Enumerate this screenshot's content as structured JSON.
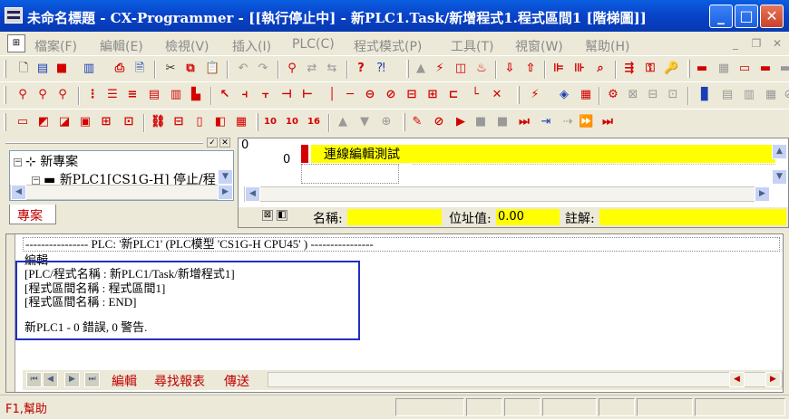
{
  "window": {
    "title": "未命名標題 - CX-Programmer - [[執行停止中] - 新PLC1.Task/新增程式1.程式區間1 [階梯圖]]",
    "minimize": "_",
    "maximize": "□",
    "close": "✕"
  },
  "menu": {
    "items": [
      "檔案(F)",
      "編輯(E)",
      "檢視(V)",
      "插入(I)",
      "PLC(C)",
      "程式模式(P)",
      "工具(T)",
      "視窗(W)",
      "幫助(H)"
    ],
    "mdi_minimize": "_",
    "mdi_restore": "❐",
    "mdi_close": "✕"
  },
  "project": {
    "root": "新專案",
    "plc": "新PLC1[CS1G-H] 停止/程",
    "tab": "專案"
  },
  "ladder": {
    "step": "0",
    "rung": "0",
    "rung_comment": "連線編輯測試",
    "name_label": "名稱:",
    "name_value": "",
    "address_label": "位址值:",
    "address_value": "0.00",
    "comment_label": "註解:",
    "comment_value": ""
  },
  "output": {
    "header": "---------------- PLC: '新PLC1' (PLC模型 'CS1G-H CPU45' ) ----------------",
    "section": "編輯",
    "lines": [
      "[PLC/程式名稱 : 新PLC1/Task/新增程式1]",
      "[程式區間名稱 : 程式區間1]",
      "[程式區間名稱 : END]",
      "新PLC1 - 0 錯誤, 0 警告."
    ],
    "tabs": [
      "編輯",
      "尋找報表",
      "傳送"
    ]
  },
  "status": {
    "help": "F1,幫助"
  },
  "colors": {
    "title_bar": "#0a5ee0",
    "highlight": "#ffff00",
    "tab_text": "#c00000",
    "focus_border": "#2030c0"
  }
}
